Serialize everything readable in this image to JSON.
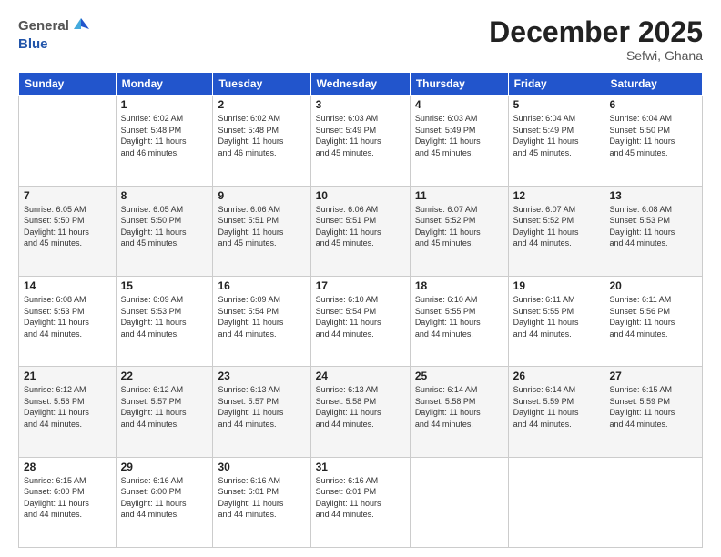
{
  "header": {
    "logo_general": "General",
    "logo_blue": "Blue",
    "title": "December 2025",
    "subtitle": "Sefwi, Ghana"
  },
  "days_of_week": [
    "Sunday",
    "Monday",
    "Tuesday",
    "Wednesday",
    "Thursday",
    "Friday",
    "Saturday"
  ],
  "weeks": [
    [
      {
        "day": "",
        "sunrise": "",
        "sunset": "",
        "daylight": ""
      },
      {
        "day": "1",
        "sunrise": "6:02 AM",
        "sunset": "5:48 PM",
        "daylight": "11 hours and 46 minutes."
      },
      {
        "day": "2",
        "sunrise": "6:02 AM",
        "sunset": "5:48 PM",
        "daylight": "11 hours and 46 minutes."
      },
      {
        "day": "3",
        "sunrise": "6:03 AM",
        "sunset": "5:49 PM",
        "daylight": "11 hours and 45 minutes."
      },
      {
        "day": "4",
        "sunrise": "6:03 AM",
        "sunset": "5:49 PM",
        "daylight": "11 hours and 45 minutes."
      },
      {
        "day": "5",
        "sunrise": "6:04 AM",
        "sunset": "5:49 PM",
        "daylight": "11 hours and 45 minutes."
      },
      {
        "day": "6",
        "sunrise": "6:04 AM",
        "sunset": "5:50 PM",
        "daylight": "11 hours and 45 minutes."
      }
    ],
    [
      {
        "day": "7",
        "sunrise": "6:05 AM",
        "sunset": "5:50 PM",
        "daylight": "11 hours and 45 minutes."
      },
      {
        "day": "8",
        "sunrise": "6:05 AM",
        "sunset": "5:50 PM",
        "daylight": "11 hours and 45 minutes."
      },
      {
        "day": "9",
        "sunrise": "6:06 AM",
        "sunset": "5:51 PM",
        "daylight": "11 hours and 45 minutes."
      },
      {
        "day": "10",
        "sunrise": "6:06 AM",
        "sunset": "5:51 PM",
        "daylight": "11 hours and 45 minutes."
      },
      {
        "day": "11",
        "sunrise": "6:07 AM",
        "sunset": "5:52 PM",
        "daylight": "11 hours and 45 minutes."
      },
      {
        "day": "12",
        "sunrise": "6:07 AM",
        "sunset": "5:52 PM",
        "daylight": "11 hours and 44 minutes."
      },
      {
        "day": "13",
        "sunrise": "6:08 AM",
        "sunset": "5:53 PM",
        "daylight": "11 hours and 44 minutes."
      }
    ],
    [
      {
        "day": "14",
        "sunrise": "6:08 AM",
        "sunset": "5:53 PM",
        "daylight": "11 hours and 44 minutes."
      },
      {
        "day": "15",
        "sunrise": "6:09 AM",
        "sunset": "5:53 PM",
        "daylight": "11 hours and 44 minutes."
      },
      {
        "day": "16",
        "sunrise": "6:09 AM",
        "sunset": "5:54 PM",
        "daylight": "11 hours and 44 minutes."
      },
      {
        "day": "17",
        "sunrise": "6:10 AM",
        "sunset": "5:54 PM",
        "daylight": "11 hours and 44 minutes."
      },
      {
        "day": "18",
        "sunrise": "6:10 AM",
        "sunset": "5:55 PM",
        "daylight": "11 hours and 44 minutes."
      },
      {
        "day": "19",
        "sunrise": "6:11 AM",
        "sunset": "5:55 PM",
        "daylight": "11 hours and 44 minutes."
      },
      {
        "day": "20",
        "sunrise": "6:11 AM",
        "sunset": "5:56 PM",
        "daylight": "11 hours and 44 minutes."
      }
    ],
    [
      {
        "day": "21",
        "sunrise": "6:12 AM",
        "sunset": "5:56 PM",
        "daylight": "11 hours and 44 minutes."
      },
      {
        "day": "22",
        "sunrise": "6:12 AM",
        "sunset": "5:57 PM",
        "daylight": "11 hours and 44 minutes."
      },
      {
        "day": "23",
        "sunrise": "6:13 AM",
        "sunset": "5:57 PM",
        "daylight": "11 hours and 44 minutes."
      },
      {
        "day": "24",
        "sunrise": "6:13 AM",
        "sunset": "5:58 PM",
        "daylight": "11 hours and 44 minutes."
      },
      {
        "day": "25",
        "sunrise": "6:14 AM",
        "sunset": "5:58 PM",
        "daylight": "11 hours and 44 minutes."
      },
      {
        "day": "26",
        "sunrise": "6:14 AM",
        "sunset": "5:59 PM",
        "daylight": "11 hours and 44 minutes."
      },
      {
        "day": "27",
        "sunrise": "6:15 AM",
        "sunset": "5:59 PM",
        "daylight": "11 hours and 44 minutes."
      }
    ],
    [
      {
        "day": "28",
        "sunrise": "6:15 AM",
        "sunset": "6:00 PM",
        "daylight": "11 hours and 44 minutes."
      },
      {
        "day": "29",
        "sunrise": "6:16 AM",
        "sunset": "6:00 PM",
        "daylight": "11 hours and 44 minutes."
      },
      {
        "day": "30",
        "sunrise": "6:16 AM",
        "sunset": "6:01 PM",
        "daylight": "11 hours and 44 minutes."
      },
      {
        "day": "31",
        "sunrise": "6:16 AM",
        "sunset": "6:01 PM",
        "daylight": "11 hours and 44 minutes."
      },
      {
        "day": "",
        "sunrise": "",
        "sunset": "",
        "daylight": ""
      },
      {
        "day": "",
        "sunrise": "",
        "sunset": "",
        "daylight": ""
      },
      {
        "day": "",
        "sunrise": "",
        "sunset": "",
        "daylight": ""
      }
    ]
  ]
}
